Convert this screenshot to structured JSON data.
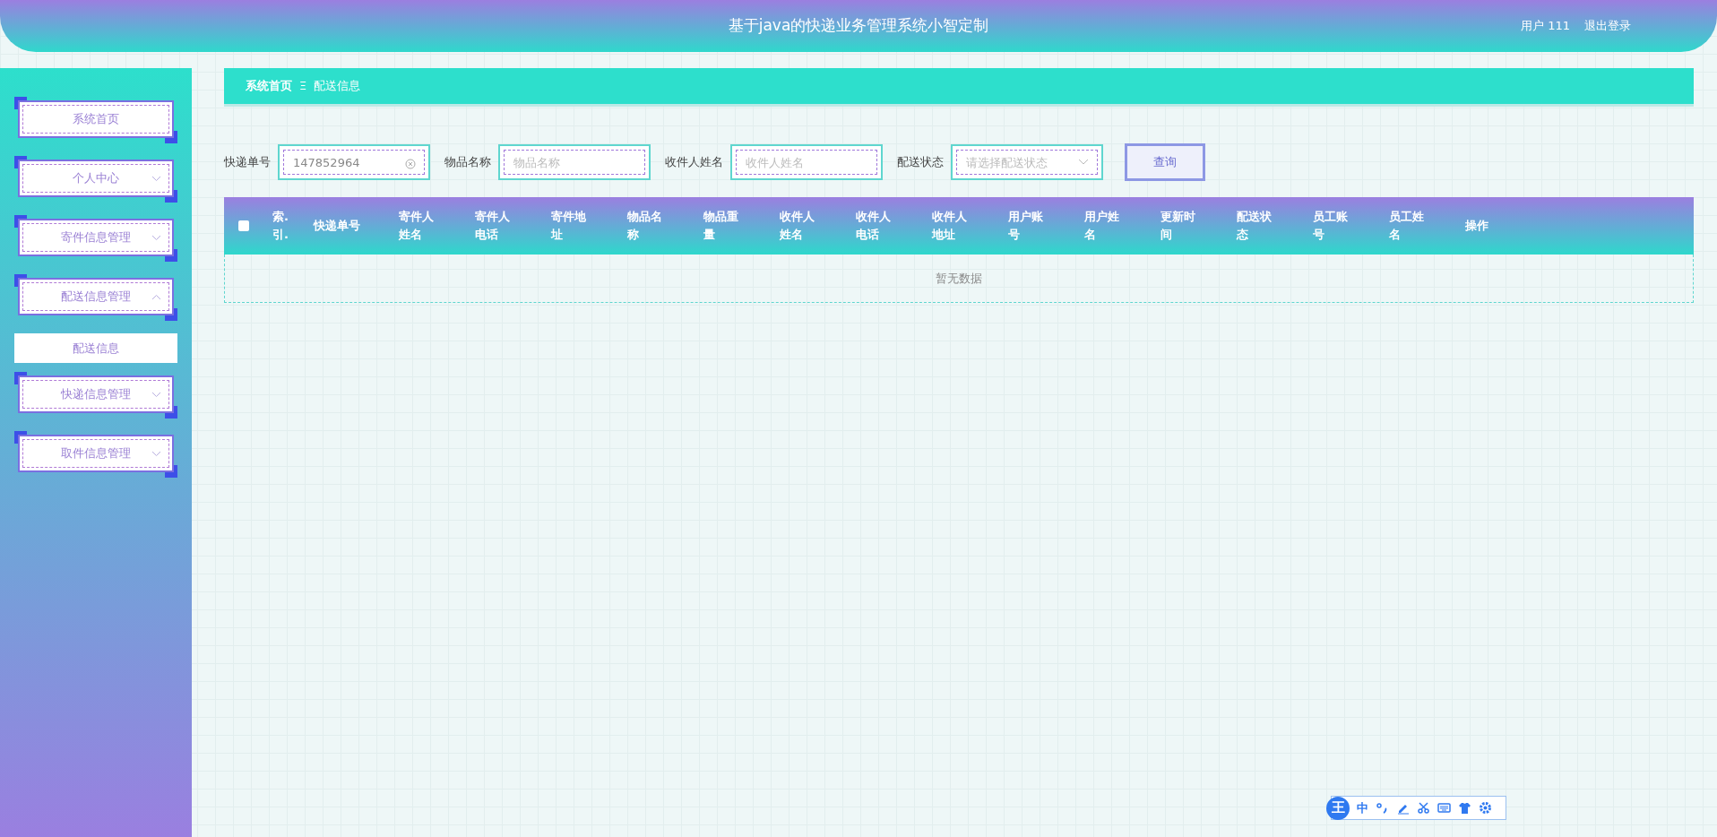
{
  "header": {
    "title": "基于java的快递业务管理系统小智定制",
    "user": "用户 111",
    "logout": "退出登录"
  },
  "sidebar": {
    "items": [
      {
        "label": "系统首页"
      },
      {
        "label": "个人中心",
        "expanded": false
      },
      {
        "label": "寄件信息管理",
        "expanded": false
      },
      {
        "label": "配送信息管理",
        "expanded": true,
        "children": [
          {
            "label": "配送信息",
            "selected": true
          }
        ]
      },
      {
        "label": "快递信息管理",
        "expanded": false
      },
      {
        "label": "取件信息管理",
        "expanded": false
      }
    ]
  },
  "breadcrumb": {
    "items": [
      "系统首页",
      "配送信息"
    ],
    "separator": "Ξ"
  },
  "search": {
    "fields": [
      {
        "label": "快递单号",
        "kind": "text",
        "value": "147852964",
        "clearable": true
      },
      {
        "label": "物品名称",
        "kind": "text",
        "placeholder": "物品名称"
      },
      {
        "label": "收件人姓名",
        "kind": "text",
        "placeholder": "收件人姓名"
      },
      {
        "label": "配送状态",
        "kind": "select",
        "placeholder": "请选择配送状态"
      }
    ],
    "button": "查询"
  },
  "table": {
    "columns": [
      "索.引.",
      "快递单号",
      "寄件人姓名",
      "寄件人电话",
      "寄件地址",
      "物品名称",
      "物品重量",
      "收件人姓名",
      "收件人电话",
      "收件人地址",
      "用户账号",
      "用户姓名",
      "更新时间",
      "配送状态",
      "员工账号",
      "员工姓名",
      "操作"
    ],
    "select_all_checked": false,
    "empty_text": "暂无数据"
  },
  "ime_toolbar": {
    "logo": "王",
    "mode": "中"
  }
}
